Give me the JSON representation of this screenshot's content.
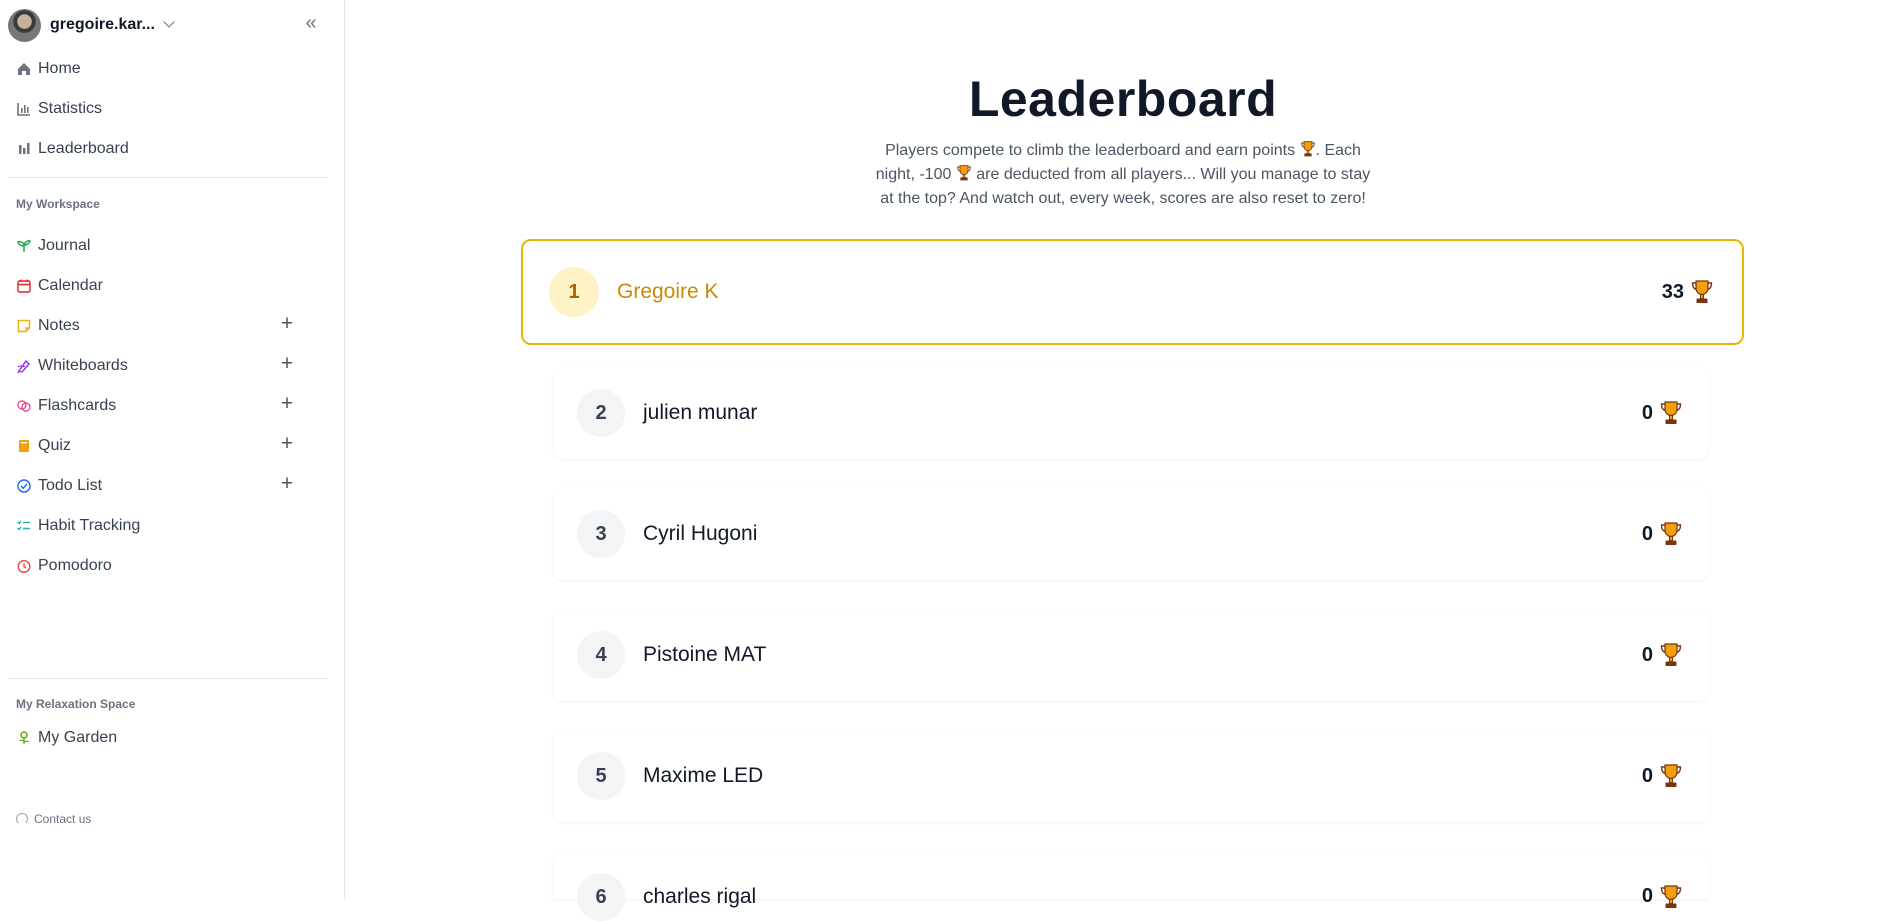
{
  "user": {
    "name": "gregoire.kar..."
  },
  "nav": {
    "main": [
      {
        "label": "Home",
        "icon": "home-icon"
      },
      {
        "label": "Statistics",
        "icon": "chart-icon"
      },
      {
        "label": "Leaderboard",
        "icon": "bar-chart-icon"
      }
    ],
    "workspace_title": "My Workspace",
    "workspace": [
      {
        "label": "Journal",
        "icon": "sprout-icon",
        "plus": false,
        "color": "#16a34a"
      },
      {
        "label": "Calendar",
        "icon": "calendar-icon",
        "plus": false,
        "color": "#dc2626"
      },
      {
        "label": "Notes",
        "icon": "sticky-note-icon",
        "plus": true,
        "color": "#eab308"
      },
      {
        "label": "Whiteboards",
        "icon": "pen-tool-icon",
        "plus": true,
        "color": "#9333ea"
      },
      {
        "label": "Flashcards",
        "icon": "brain-icon",
        "plus": true,
        "color": "#ec4899"
      },
      {
        "label": "Quiz",
        "icon": "book-icon",
        "plus": true,
        "color": "#f59e0b"
      },
      {
        "label": "Todo List",
        "icon": "check-circle-icon",
        "plus": true,
        "color": "#2563eb"
      },
      {
        "label": "Habit Tracking",
        "icon": "list-checks-icon",
        "plus": false,
        "color": "#14b8a6"
      },
      {
        "label": "Pomodoro",
        "icon": "timer-icon",
        "plus": false,
        "color": "#ef4444"
      }
    ],
    "relax_title": "My Relaxation Space",
    "relax": [
      {
        "label": "My Garden",
        "icon": "flower-icon",
        "color": "#65a30d"
      }
    ],
    "contact": "Contact us"
  },
  "page": {
    "title": "Leaderboard",
    "subtitle_parts": [
      "Players compete to climb the leaderboard and earn points ",
      ". Each night, -100 ",
      " are deducted from all players... Will you manage to stay at the top? And watch out, every week, scores are also reset to zero!"
    ]
  },
  "players": [
    {
      "rank": "1",
      "name": "Gregoire K",
      "score": "33"
    },
    {
      "rank": "2",
      "name": "julien munar",
      "score": "0"
    },
    {
      "rank": "3",
      "name": "Cyril Hugoni",
      "score": "0"
    },
    {
      "rank": "4",
      "name": "Pistoine MAT",
      "score": "0"
    },
    {
      "rank": "5",
      "name": "Maxime LED",
      "score": "0"
    },
    {
      "rank": "6",
      "name": "charles rigal",
      "score": "0"
    }
  ],
  "colors": {
    "accent": "#eab308",
    "trophy": "#f59e0b"
  }
}
